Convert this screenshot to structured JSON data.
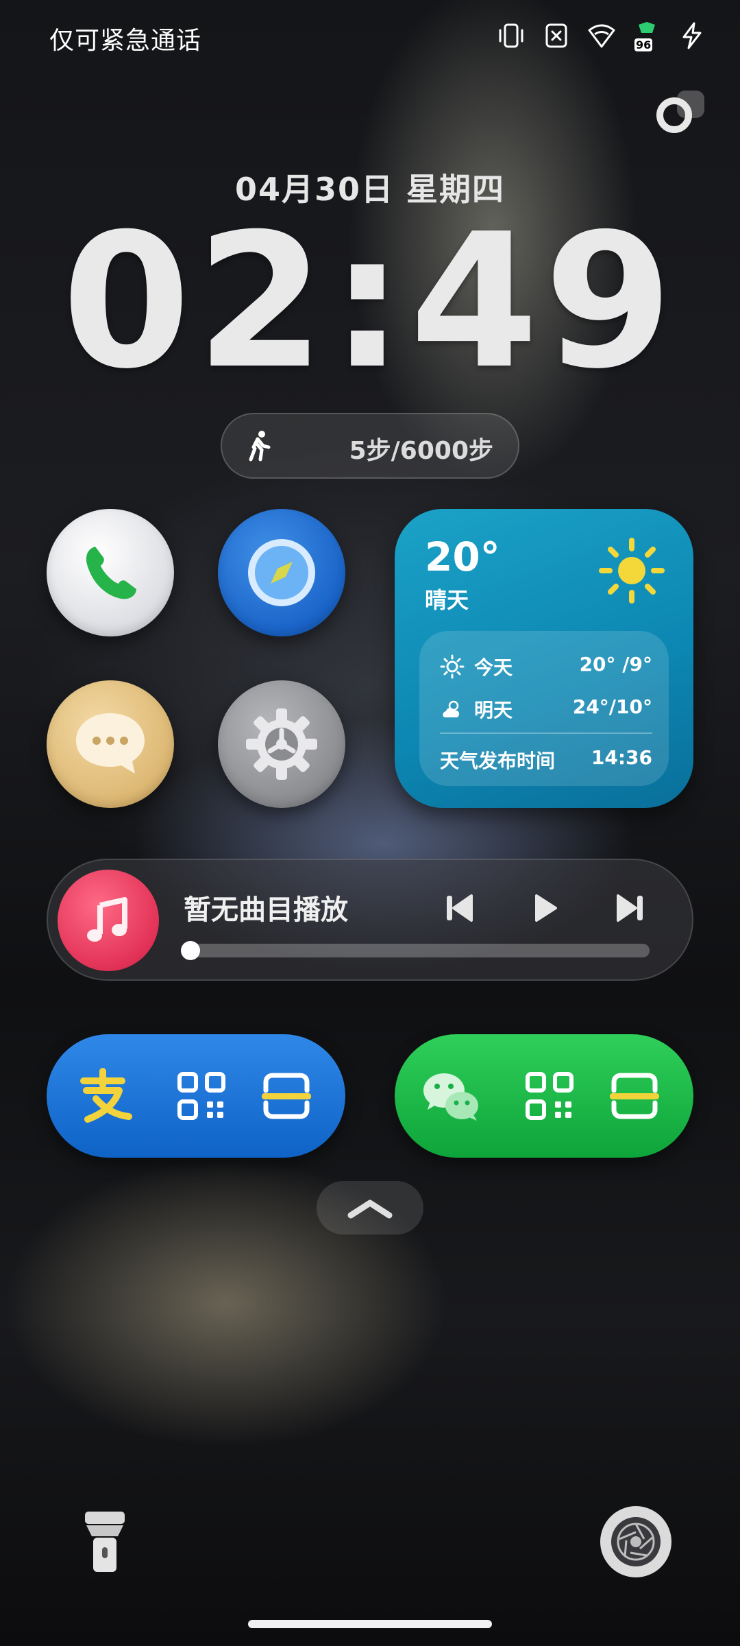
{
  "status_bar": {
    "carrier_text": "仅可紧急通话",
    "battery_level": "96"
  },
  "lock": {
    "date": "04月30日 星期四",
    "time": "02:49"
  },
  "steps": {
    "text": "5步/6000步"
  },
  "weather": {
    "temperature": "20°",
    "condition": "晴天",
    "today_label": "今天",
    "today_range": "20° /9°",
    "tomorrow_label": "明天",
    "tomorrow_range": "24°/10°",
    "update_label": "天气发布时间",
    "update_time": "14:36",
    "accent": "#1ba2c7"
  },
  "music": {
    "title": "暂无曲目播放",
    "accent": "#e23257"
  },
  "colors": {
    "alipay": "#1f74d8",
    "wechat": "#17b445"
  }
}
